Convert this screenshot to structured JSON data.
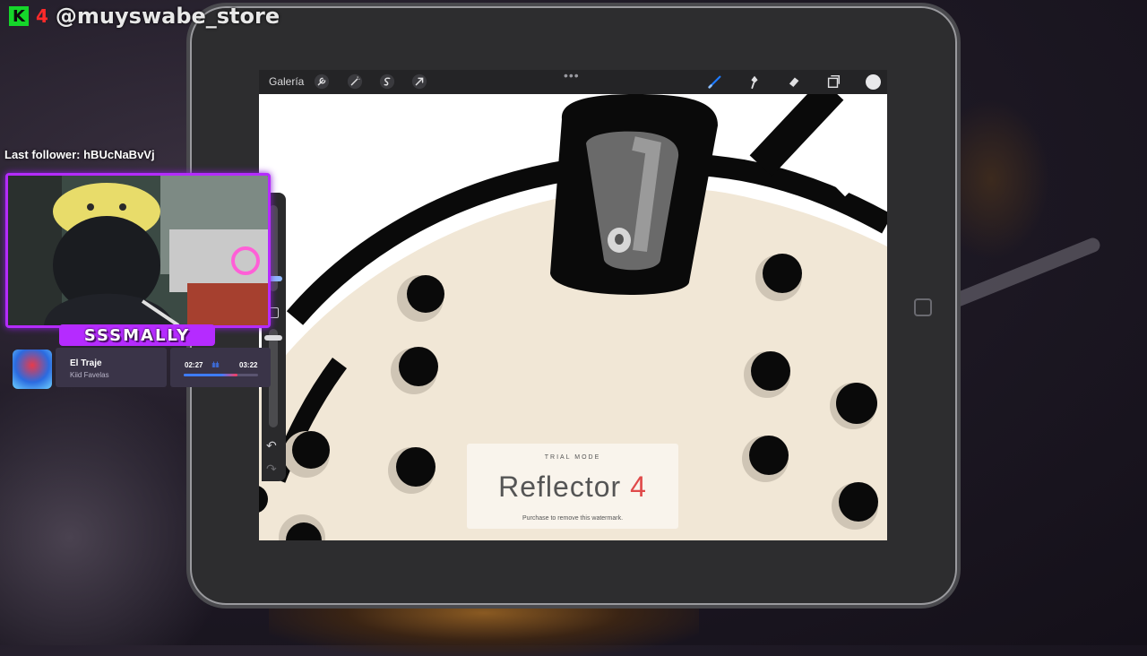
{
  "stream": {
    "brand_k": "K",
    "brand_four": "4",
    "handle": "@muyswabe_store",
    "last_follower": "Last follower: hBUcNaBvVj",
    "cam_name": "SSSMALLY"
  },
  "music": {
    "title": "El Traje",
    "artist": "Kiid Favelas",
    "current": "02:27",
    "total": "03:22",
    "eq": "ılıılı",
    "progress_fraction": 0.72
  },
  "procreate": {
    "gallery_label": "Galería",
    "more_dots": "•••",
    "toolbar_left_icons": [
      "wrench-icon",
      "magic-wand-icon",
      "selection-icon",
      "transform-arrow-icon"
    ],
    "toolbar_right_icons": [
      "brush-icon",
      "smudge-icon",
      "eraser-icon",
      "layers-icon",
      "color-icon"
    ],
    "brush_color": "#1e7bff",
    "current_color": "#e8e8ea",
    "undo_symbol": "↶",
    "redo_symbol": "↷"
  },
  "watermark": {
    "mode": "TRIAL MODE",
    "product": "Reflector",
    "version": "4",
    "note": "Purchase to remove this watermark."
  },
  "colors": {
    "cam_border": "#b52bff",
    "canvas_fill": "#f1e7d6",
    "brand_green": "#15d62a",
    "brand_red": "#ff2a2a"
  }
}
